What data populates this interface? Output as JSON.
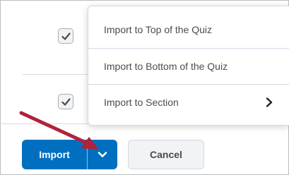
{
  "menu": {
    "items": [
      {
        "label": "Import to Top of the Quiz"
      },
      {
        "label": "Import to Bottom of the Quiz"
      },
      {
        "label": "Import to Section",
        "icon": "chevron-right-icon"
      }
    ]
  },
  "actions": {
    "import_label": "Import",
    "import_toggle_icon": "chevron-down-icon",
    "cancel_label": "Cancel"
  },
  "rows": [
    {
      "checked": true
    },
    {
      "checked": true
    }
  ],
  "colors": {
    "primary": "#006fbf",
    "annotation_arrow": "#b0223a",
    "text": "#494c4e",
    "divider": "#d3d9e3"
  }
}
